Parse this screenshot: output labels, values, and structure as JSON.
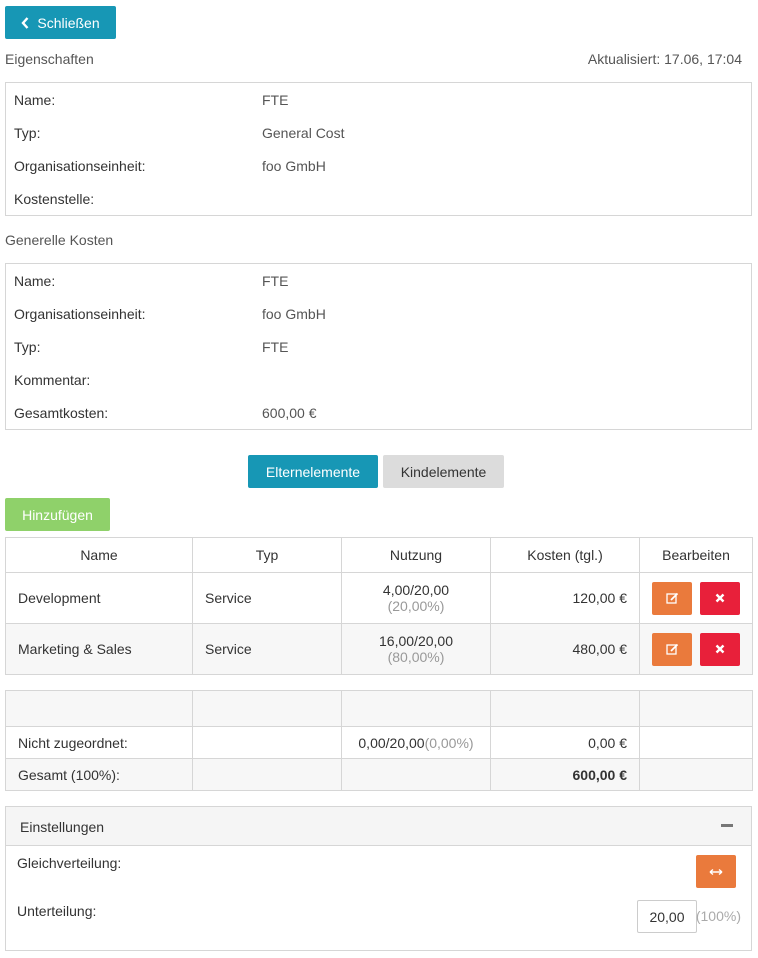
{
  "close_button": {
    "label": "Schließen",
    "icon": "chevron-left-icon"
  },
  "properties": {
    "title": "Eigenschaften",
    "updated": "Aktualisiert: 17.06, 17:04",
    "rows": [
      {
        "key": "Name:",
        "value": "FTE"
      },
      {
        "key": "Typ:",
        "value": "General Cost"
      },
      {
        "key": "Organisationseinheit:",
        "value": "foo GmbH"
      },
      {
        "key": "Kostenstelle:",
        "value": ""
      }
    ]
  },
  "general_costs": {
    "title": "Generelle Kosten",
    "rows": [
      {
        "key": "Name:",
        "value": "FTE"
      },
      {
        "key": "Organisationseinheit:",
        "value": "foo GmbH"
      },
      {
        "key": "Typ:",
        "value": "FTE"
      },
      {
        "key": "Kommentar:",
        "value": ""
      },
      {
        "key": "Gesamtkosten:",
        "value": "600,00 €"
      }
    ]
  },
  "tabs": {
    "parents": "Elternelemente",
    "children": "Kindelemente"
  },
  "add_button": "Hinzufügen",
  "table": {
    "headers": [
      "Name",
      "Typ",
      "Nutzung",
      "Kosten (tgl.)",
      "Bearbeiten"
    ],
    "rows": [
      {
        "name": "Development",
        "type": "Service",
        "usage": "4,00/20,00",
        "usage_pct": "(20,00%)",
        "cost": "120,00 €"
      },
      {
        "name": "Marketing & Sales",
        "type": "Service",
        "usage": "16,00/20,00",
        "usage_pct": "(80,00%)",
        "cost": "480,00 €"
      }
    ]
  },
  "summary": {
    "unassigned_label": "Nicht zugeordnet:",
    "unassigned_usage": "0,00/20,00",
    "unassigned_pct": "(0,00%)",
    "unassigned_cost": "0,00 €",
    "total_label": "Gesamt (100%):",
    "total_cost": "600,00 €"
  },
  "settings": {
    "title": "Einstellungen",
    "equal_label": "Gleichverteilung:",
    "division_label": "Unterteilung:",
    "division_value": "20,00",
    "division_pct": "(100%)"
  },
  "colors": {
    "primary": "#1797b5",
    "success": "#8fd16a",
    "warning": "#ea7a3c",
    "danger": "#e8203a"
  }
}
